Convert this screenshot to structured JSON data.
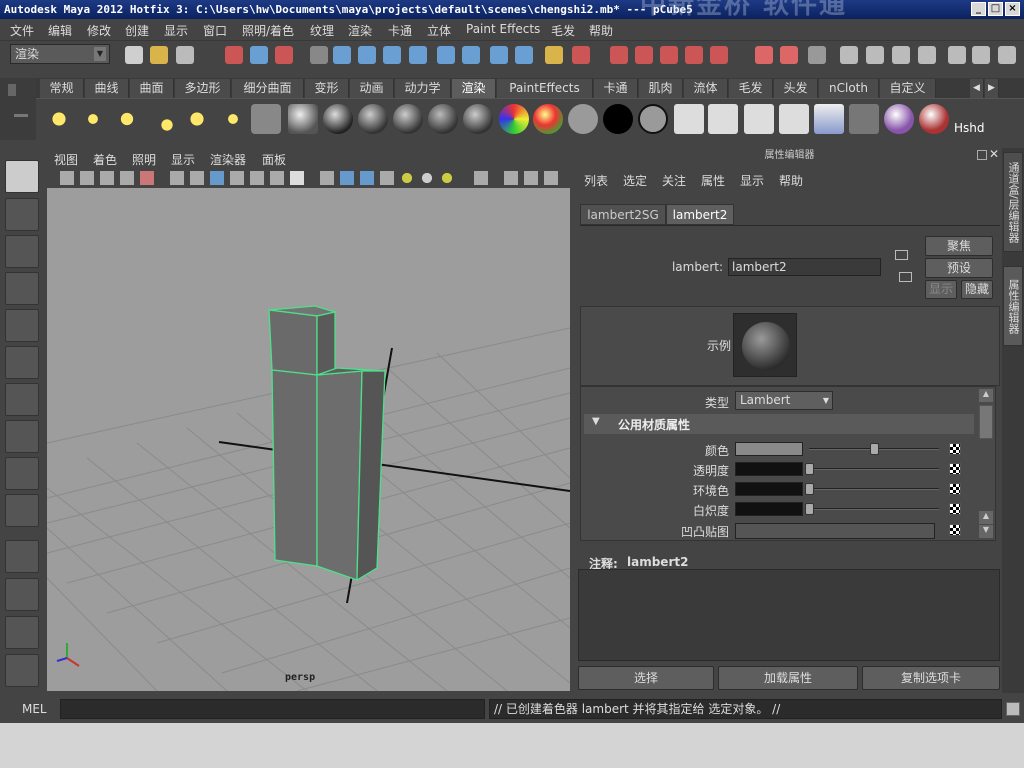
{
  "window": {
    "title": "Autodesk Maya 2012 Hotfix 3: C:\\Users\\hw\\Documents\\maya\\projects\\default\\scenes\\chengshi2.mb*    ---    pCube5",
    "watermark": "中新金桥 软件通",
    "minimize": "_",
    "maximize": "□",
    "close": "×"
  },
  "menu": [
    "文件",
    "编辑",
    "修改",
    "创建",
    "显示",
    "窗口",
    "照明/着色",
    "纹理",
    "渲染",
    "卡通",
    "立体",
    "Paint Effects",
    "毛发",
    "帮助"
  ],
  "status": {
    "mode": "渲染"
  },
  "shelf": {
    "tabs": [
      "常规",
      "曲线",
      "曲面",
      "多边形",
      "细分曲面",
      "变形",
      "动画",
      "动力学",
      "渲染",
      "PaintEffects",
      "卡通",
      "肌肉",
      "流体",
      "毛发",
      "头发",
      "nCloth",
      "自定义"
    ],
    "active_tab": "渲染",
    "hshd_label": "Hshd"
  },
  "viewport": {
    "menu": [
      "视图",
      "着色",
      "照明",
      "显示",
      "渲染器",
      "面板"
    ],
    "camera_label": "persp"
  },
  "attribute_editor": {
    "header": "属性编辑器",
    "menu": [
      "列表",
      "选定",
      "关注",
      "属性",
      "显示",
      "帮助"
    ],
    "tabs": [
      "lambert2SG",
      "lambert2"
    ],
    "active_tab": "lambert2",
    "node_label": "lambert:",
    "node_name": "lambert2",
    "buttons": {
      "focus": "聚焦",
      "presets": "预设",
      "show": "显示",
      "hide": "隐藏"
    },
    "sample_label": "示例",
    "type_label": "类型",
    "type_value": "Lambert",
    "section_title": "公用材质属性",
    "attributes": [
      {
        "label": "颜色",
        "swatch": "#8a8a8a",
        "value": 0.5
      },
      {
        "label": "透明度",
        "swatch": "#111111",
        "value": 0.0
      },
      {
        "label": "环境色",
        "swatch": "#111111",
        "value": 0.0
      },
      {
        "label": "白炽度",
        "swatch": "#111111",
        "value": 0.0
      },
      {
        "label": "凹凸贴图",
        "swatch": "",
        "value": null
      }
    ],
    "notes_label": "注释:",
    "notes_node": "lambert2",
    "bottom_buttons": [
      "选择",
      "加载属性",
      "复制选项卡"
    ]
  },
  "side_tabs": [
    "通道盒/层编辑器",
    "属性编辑器"
  ],
  "command_line": {
    "label": "MEL",
    "result": "// 已创建着色器 lambert 并将其指定给 选定对象。 //"
  }
}
